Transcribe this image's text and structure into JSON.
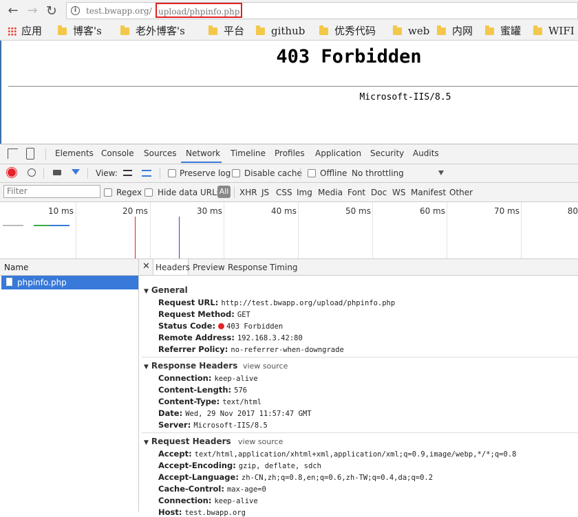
{
  "browser": {
    "url_host": "test.bwapp.org/",
    "url_path": "upload/phpinfo.php"
  },
  "bookmarks": [
    {
      "label": "应用",
      "type": "apps"
    },
    {
      "label": "博客's",
      "type": "folder"
    },
    {
      "label": "老外博客's",
      "type": "folder"
    },
    {
      "label": "平台",
      "type": "folder"
    },
    {
      "label": "github",
      "type": "folder"
    },
    {
      "label": "优秀代码",
      "type": "folder"
    },
    {
      "label": "web",
      "type": "folder"
    },
    {
      "label": "内网",
      "type": "folder"
    },
    {
      "label": "蜜罐",
      "type": "folder"
    },
    {
      "label": "WIFI",
      "type": "folder"
    }
  ],
  "page": {
    "title": "403 Forbidden",
    "server": "Microsoft-IIS/8.5"
  },
  "devtools": {
    "tabs": [
      "Elements",
      "Console",
      "Sources",
      "Network",
      "Timeline",
      "Profiles",
      "Application",
      "Security",
      "Audits"
    ],
    "active_tab": "Network",
    "toolbar": {
      "view_label": "View:",
      "preserve_log": "Preserve log",
      "disable_cache": "Disable cache",
      "offline": "Offline",
      "throttling": "No throttling"
    },
    "filterbar": {
      "filter_placeholder": "Filter",
      "regex": "Regex",
      "hide_data_urls": "Hide data URLs",
      "all": "All",
      "types": [
        "XHR",
        "JS",
        "CSS",
        "Img",
        "Media",
        "Font",
        "Doc",
        "WS",
        "Manifest",
        "Other"
      ]
    },
    "timeline_ticks": [
      "10 ms",
      "20 ms",
      "30 ms",
      "40 ms",
      "50 ms",
      "60 ms",
      "70 ms",
      "80"
    ],
    "name_header": "Name",
    "request": "phpinfo.php",
    "detail_tabs": [
      "Headers",
      "Preview",
      "Response",
      "Timing"
    ],
    "view_source": "view source",
    "general": {
      "title": "General",
      "rows": [
        {
          "k": "Request URL:",
          "v": "http://test.bwapp.org/upload/phpinfo.php"
        },
        {
          "k": "Request Method:",
          "v": "GET"
        },
        {
          "k": "Status Code:",
          "v": "403 Forbidden"
        },
        {
          "k": "Remote Address:",
          "v": "192.168.3.42:80"
        },
        {
          "k": "Referrer Policy:",
          "v": "no-referrer-when-downgrade"
        }
      ]
    },
    "response_headers": {
      "title": "Response Headers",
      "rows": [
        {
          "k": "Connection:",
          "v": "keep-alive"
        },
        {
          "k": "Content-Length:",
          "v": "576"
        },
        {
          "k": "Content-Type:",
          "v": "text/html"
        },
        {
          "k": "Date:",
          "v": "Wed, 29 Nov 2017 11:57:47 GMT"
        },
        {
          "k": "Server:",
          "v": "Microsoft-IIS/8.5"
        }
      ]
    },
    "request_headers": {
      "title": "Request Headers",
      "rows": [
        {
          "k": "Accept:",
          "v": "text/html,application/xhtml+xml,application/xml;q=0.9,image/webp,*/*;q=0.8"
        },
        {
          "k": "Accept-Encoding:",
          "v": "gzip, deflate, sdch"
        },
        {
          "k": "Accept-Language:",
          "v": "zh-CN,zh;q=0.8,en;q=0.6,zh-TW;q=0.4,da;q=0.2"
        },
        {
          "k": "Cache-Control:",
          "v": "max-age=0"
        },
        {
          "k": "Connection:",
          "v": "keep-alive"
        },
        {
          "k": "Host:",
          "v": "test.bwapp.org"
        }
      ]
    }
  }
}
